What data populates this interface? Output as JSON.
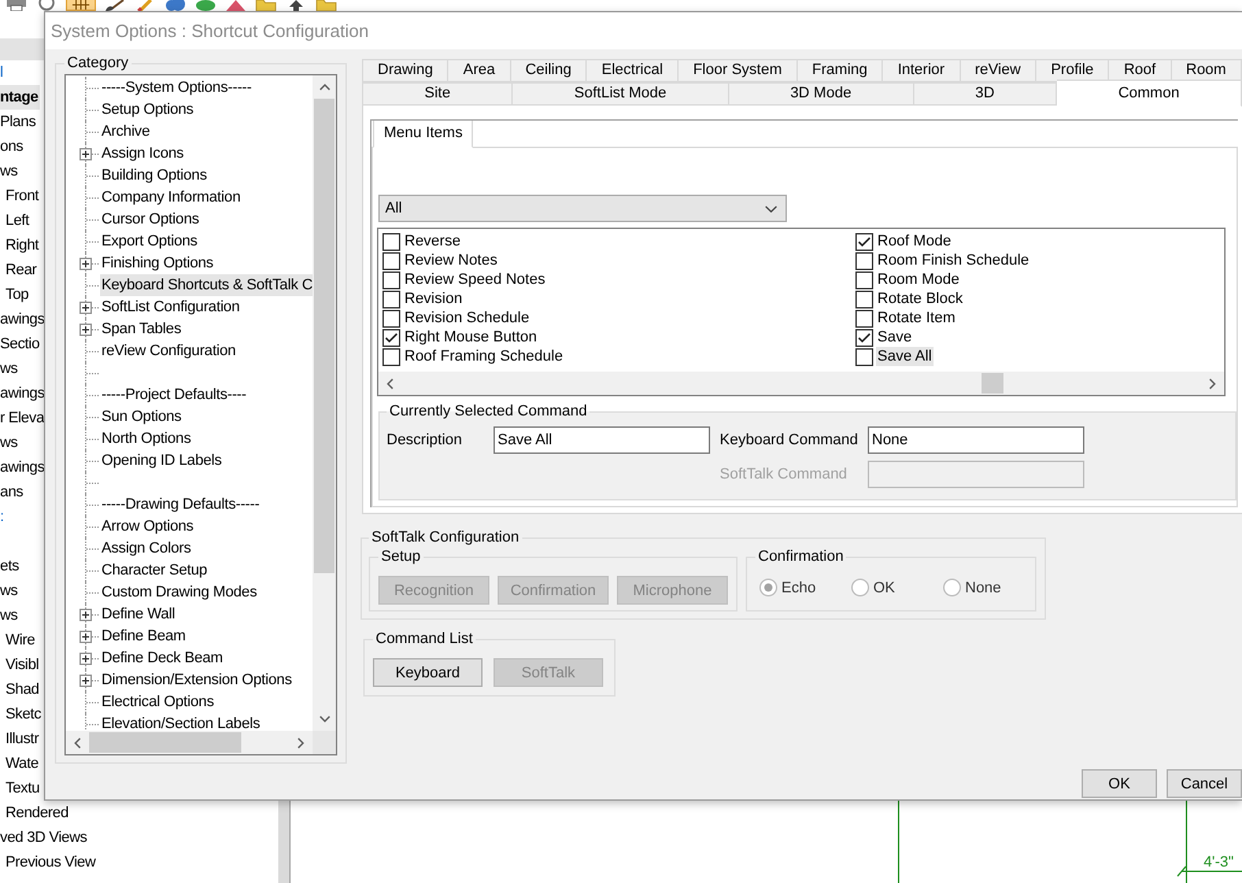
{
  "background_app": {
    "toolbar": [
      {
        "kind": "printer",
        "selected": false
      },
      {
        "kind": "ring",
        "selected": false
      },
      {
        "kind": "grid",
        "selected": true
      },
      {
        "kind": "brush",
        "selected": false
      },
      {
        "kind": "pencil",
        "selected": false
      },
      {
        "kind": "cloud",
        "selected": false
      },
      {
        "kind": "ellipse",
        "selected": false
      },
      {
        "kind": "triangle",
        "selected": false
      },
      {
        "kind": "folder",
        "selected": false
      },
      {
        "kind": "arrow",
        "selected": false
      },
      {
        "kind": "folder",
        "selected": false
      }
    ],
    "tree": [
      {
        "label": "l",
        "kind": "link",
        "selected": false
      },
      {
        "label": "ntage",
        "kind": "current",
        "selected": true
      },
      {
        "label": "Plans",
        "kind": "item",
        "selected": false
      },
      {
        "label": "ons",
        "kind": "item",
        "selected": false
      },
      {
        "label": "ws",
        "kind": "item",
        "selected": false,
        "children": [
          {
            "label": "Front",
            "kind": "item",
            "selected": false
          },
          {
            "label": "Left",
            "kind": "item",
            "selected": false
          },
          {
            "label": "Right",
            "kind": "item",
            "selected": false
          },
          {
            "label": "Rear",
            "kind": "item",
            "selected": false
          },
          {
            "label": "Top",
            "kind": "item",
            "selected": false
          }
        ]
      },
      {
        "label": "awings",
        "kind": "item",
        "selected": false
      },
      {
        "label": "Sectio",
        "kind": "item",
        "selected": false
      },
      {
        "label": "ws",
        "kind": "item",
        "selected": false
      },
      {
        "label": "awings",
        "kind": "item",
        "selected": false
      },
      {
        "label": "r Eleva",
        "kind": "item",
        "selected": false
      },
      {
        "label": "ws",
        "kind": "item",
        "selected": false
      },
      {
        "label": "awings",
        "kind": "item",
        "selected": false
      },
      {
        "label": "ans",
        "kind": "item",
        "selected": false
      },
      {
        "label": ":",
        "kind": "link",
        "selected": false
      },
      {
        "kind": "spacer"
      },
      {
        "label": "ets",
        "kind": "item",
        "selected": false
      },
      {
        "label": "ws",
        "kind": "item",
        "selected": false
      },
      {
        "label": "ws",
        "kind": "item",
        "selected": false,
        "children": [
          {
            "label": "Wire",
            "kind": "item",
            "selected": false
          },
          {
            "label": "Visibl",
            "kind": "item",
            "selected": false
          },
          {
            "label": "Shad",
            "kind": "item",
            "selected": false
          },
          {
            "label": "Sketc",
            "kind": "item",
            "selected": false
          },
          {
            "label": "Illustr",
            "kind": "item",
            "selected": false
          },
          {
            "label": "Wate",
            "kind": "item",
            "selected": false
          },
          {
            "label": "Textu",
            "kind": "item",
            "selected": false
          },
          {
            "label": "Rendered",
            "kind": "item",
            "selected": false
          }
        ]
      },
      {
        "label": "ved 3D Views",
        "kind": "item",
        "selected": false,
        "children": [
          {
            "label": "Previous View",
            "kind": "item",
            "selected": false
          }
        ]
      }
    ],
    "canvas": {
      "dimension_label": "4'-3\""
    }
  },
  "dialog": {
    "title": "System Options : Shortcut Configuration",
    "category": {
      "title": "Category",
      "items": [
        {
          "label": "-----System Options-----",
          "kind": "leaf",
          "selected": false
        },
        {
          "label": "Setup Options",
          "kind": "leaf",
          "selected": false
        },
        {
          "label": "Archive",
          "kind": "leaf",
          "selected": false
        },
        {
          "label": "Assign Icons",
          "kind": "node",
          "expanded": false,
          "selected": false
        },
        {
          "label": "Building Options",
          "kind": "leaf",
          "selected": false
        },
        {
          "label": "Company Information",
          "kind": "leaf",
          "selected": false
        },
        {
          "label": "Cursor Options",
          "kind": "leaf",
          "selected": false
        },
        {
          "label": "Export Options",
          "kind": "leaf",
          "selected": false
        },
        {
          "label": "Finishing Options",
          "kind": "node",
          "expanded": false,
          "selected": false
        },
        {
          "label": "Keyboard Shortcuts & SoftTalk C",
          "kind": "leaf",
          "selected": true
        },
        {
          "label": "SoftList Configuration",
          "kind": "node",
          "expanded": false,
          "selected": false
        },
        {
          "label": "Span Tables",
          "kind": "node",
          "expanded": false,
          "selected": false
        },
        {
          "label": "reView Configuration",
          "kind": "leaf",
          "selected": false
        },
        {
          "kind": "spacer"
        },
        {
          "label": "-----Project Defaults----",
          "kind": "leaf",
          "selected": false
        },
        {
          "label": "Sun Options",
          "kind": "leaf",
          "selected": false
        },
        {
          "label": "North Options",
          "kind": "leaf",
          "selected": false
        },
        {
          "label": "Opening ID Labels",
          "kind": "leaf",
          "selected": false
        },
        {
          "kind": "spacer"
        },
        {
          "label": "-----Drawing Defaults-----",
          "kind": "leaf",
          "selected": false
        },
        {
          "label": "Arrow Options",
          "kind": "leaf",
          "selected": false
        },
        {
          "label": "Assign Colors",
          "kind": "leaf",
          "selected": false
        },
        {
          "label": "Character Setup",
          "kind": "leaf",
          "selected": false
        },
        {
          "label": "Custom Drawing Modes",
          "kind": "leaf",
          "selected": false
        },
        {
          "label": "Define Wall",
          "kind": "node",
          "expanded": false,
          "selected": false
        },
        {
          "label": "Define Beam",
          "kind": "node",
          "expanded": false,
          "selected": false
        },
        {
          "label": "Define Deck Beam",
          "kind": "node",
          "expanded": false,
          "selected": false
        },
        {
          "label": "Dimension/Extension Options",
          "kind": "node",
          "expanded": false,
          "selected": false
        },
        {
          "label": "Electrical Options",
          "kind": "leaf",
          "selected": false
        },
        {
          "label": "Elevation/Section Labels",
          "kind": "leaf",
          "selected": false
        }
      ]
    },
    "tab_rows": [
      [
        {
          "label": "Drawing",
          "selected": false
        },
        {
          "label": "Area",
          "selected": false
        },
        {
          "label": "Ceiling",
          "selected": false
        },
        {
          "label": "Electrical",
          "selected": false
        },
        {
          "label": "Floor System",
          "selected": false
        },
        {
          "label": "Framing",
          "selected": false
        },
        {
          "label": "Interior",
          "selected": false
        },
        {
          "label": "reView",
          "selected": false
        },
        {
          "label": "Profile",
          "selected": false
        },
        {
          "label": "Roof",
          "selected": false
        },
        {
          "label": "Room",
          "selected": false
        }
      ],
      [
        {
          "label": "Site",
          "selected": false
        },
        {
          "label": "SoftList Mode",
          "selected": false
        },
        {
          "label": "3D Mode",
          "selected": false
        },
        {
          "label": "3D",
          "selected": false
        },
        {
          "label": "Common",
          "selected": true
        }
      ]
    ],
    "sub_tabs": [
      {
        "label": "Menu Items",
        "selected": true
      }
    ],
    "filter": {
      "value": "All"
    },
    "commands": [
      {
        "label": "Reverse",
        "checked": false,
        "selected": false
      },
      {
        "label": "Review Notes",
        "checked": false,
        "selected": false
      },
      {
        "label": "Review Speed Notes",
        "checked": false,
        "selected": false
      },
      {
        "label": "Revision",
        "checked": false,
        "selected": false
      },
      {
        "label": "Revision Schedule",
        "checked": false,
        "selected": false
      },
      {
        "label": "Right Mouse Button",
        "checked": true,
        "selected": false
      },
      {
        "label": "Roof Framing Schedule",
        "checked": false,
        "selected": false
      },
      {
        "label": "Roof Mode",
        "checked": true,
        "selected": false
      },
      {
        "label": "Room Finish Schedule",
        "checked": false,
        "selected": false
      },
      {
        "label": "Room Mode",
        "checked": false,
        "selected": false
      },
      {
        "label": "Rotate Block",
        "checked": false,
        "selected": false
      },
      {
        "label": "Rotate Item",
        "checked": false,
        "selected": false
      },
      {
        "label": "Save",
        "checked": true,
        "selected": false
      },
      {
        "label": "Save All",
        "checked": false,
        "selected": true
      }
    ],
    "selected_command": {
      "title": "Currently Selected Command",
      "columns": [
        [
          {
            "label": "Description",
            "value": "Save All",
            "disabled": false
          }
        ],
        [
          {
            "label": "Keyboard Command",
            "value": "None",
            "disabled": false
          },
          {
            "label": "SoftTalk Command",
            "disabled": true
          }
        ]
      ]
    },
    "softtalk": {
      "title": "SoftTalk Configuration",
      "setup": {
        "title": "Setup",
        "buttons": [
          {
            "label": "Recognition",
            "disabled": true
          },
          {
            "label": "Confirmation",
            "disabled": true
          },
          {
            "label": "Microphone",
            "disabled": true
          }
        ]
      },
      "confirmation": {
        "title": "Confirmation",
        "options": [
          {
            "label": "Echo",
            "selected": true
          },
          {
            "label": "OK",
            "selected": false
          },
          {
            "label": "None",
            "selected": false
          }
        ]
      }
    },
    "command_list": {
      "title": "Command List",
      "buttons": [
        {
          "label": "Keyboard",
          "disabled": false
        },
        {
          "label": "SoftTalk",
          "disabled": true
        }
      ]
    },
    "buttons": [
      {
        "label": "OK"
      },
      {
        "label": "Cancel"
      }
    ]
  }
}
